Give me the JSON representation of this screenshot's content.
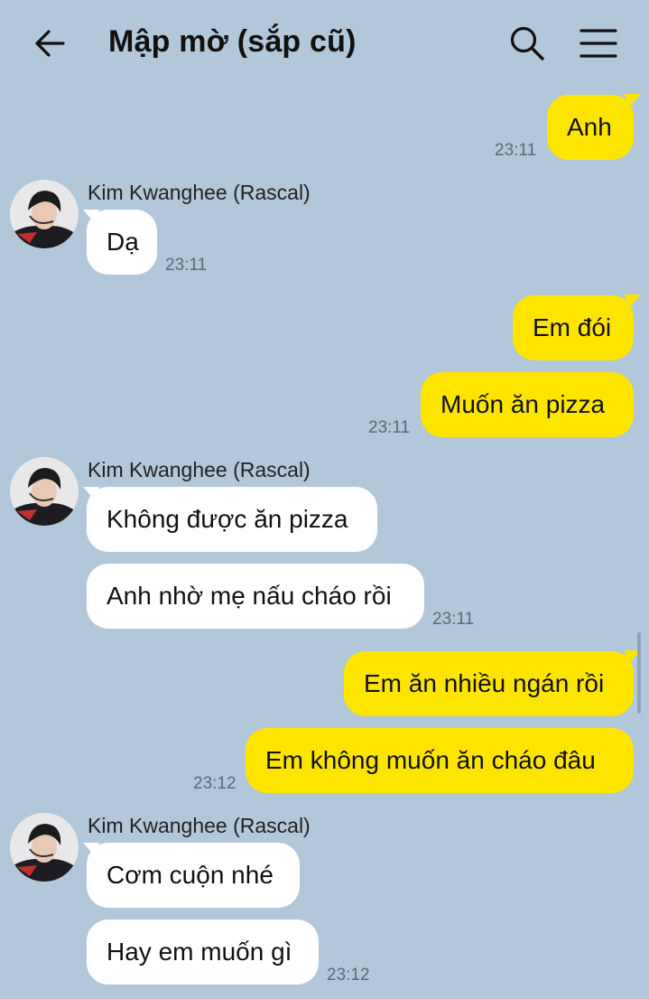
{
  "header": {
    "title": "Mập mờ (sắp cũ)",
    "back_icon": "arrow-left-icon",
    "search_icon": "search-icon",
    "menu_icon": "hamburger-menu-icon"
  },
  "colors": {
    "background": "#b2c7da",
    "outgoing_bubble": "#fee500",
    "incoming_bubble": "#ffffff"
  },
  "messages": [
    {
      "text": "Anh",
      "time": "23:11"
    },
    {
      "sender": "Kim Kwanghee (Rascal)",
      "text": "Dạ",
      "time": "23:11"
    },
    {
      "text": "Em đói"
    },
    {
      "text": "Muốn ăn pizza",
      "time": "23:11"
    },
    {
      "sender": "Kim Kwanghee (Rascal)",
      "text": "Không được ăn pizza"
    },
    {
      "text": "Anh nhờ mẹ nấu cháo rồi",
      "time": "23:11"
    },
    {
      "text": "Em ăn nhiều ngán rồi"
    },
    {
      "text": "Em không muốn ăn cháo đâu",
      "time": "23:12"
    },
    {
      "sender": "Kim Kwanghee (Rascal)",
      "text": "Cơm cuộn nhé"
    },
    {
      "text": "Hay em muốn gì",
      "time": "23:12"
    }
  ]
}
